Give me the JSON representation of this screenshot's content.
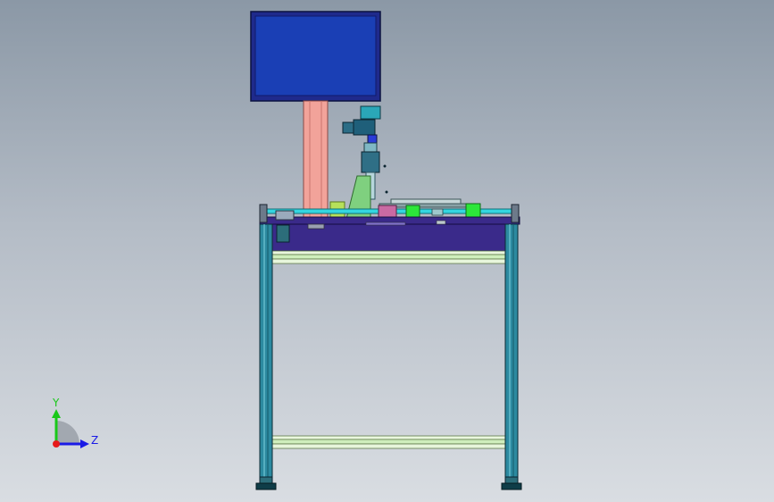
{
  "viewport": {
    "background_top": "#8b98a6",
    "background_bottom": "#d9dde2"
  },
  "triad": {
    "y_label": "Y",
    "z_label": "Z",
    "y_color": "#19c819",
    "z_color": "#1a1ae6",
    "x_color": "#e61919"
  },
  "colors": {
    "monitor_frame": "#1f2a8c",
    "monitor_screen": "#1a3fb5",
    "column": "#f2a39a",
    "frame_post": "#2c8aa0",
    "table_top": "#3a2a8a",
    "cyan_rail": "#34d6e0",
    "green_block": "#2ce63a",
    "rung": "#d8f2c8"
  },
  "icons": {
    "triad": "view-orientation-triad-icon"
  }
}
